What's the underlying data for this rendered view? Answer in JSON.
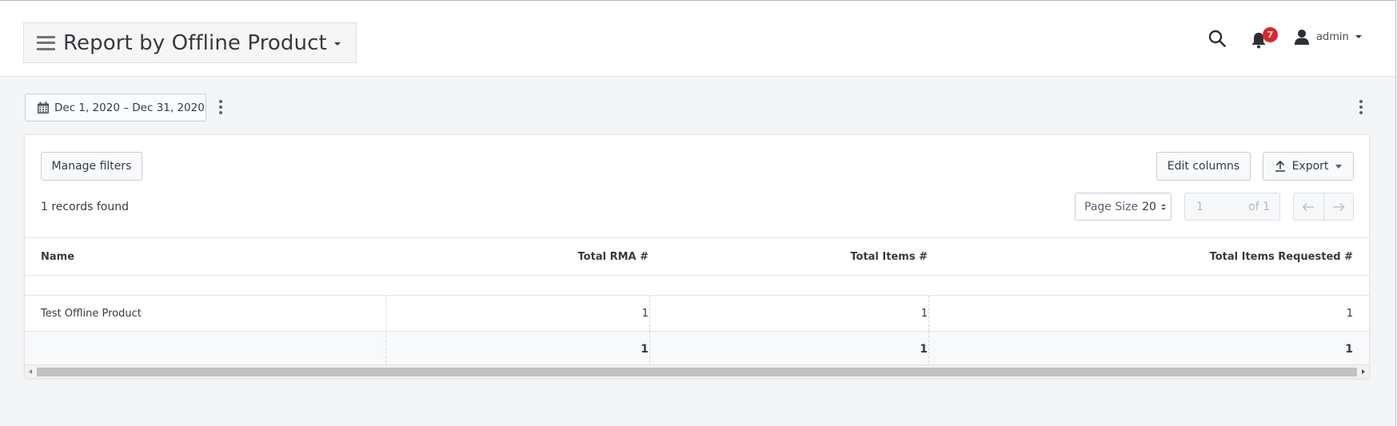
{
  "header": {
    "title": "Report by Offline Product",
    "notifications_count": "7",
    "user_name": "admin",
    "badge_color": "#e2232a"
  },
  "toolbar": {
    "date_range": "Dec 1, 2020 – Dec 31, 2020"
  },
  "grid": {
    "manage_filters_label": "Manage filters",
    "edit_columns_label": "Edit columns",
    "export_label": "Export",
    "records_found": "1 records found",
    "page_size_label": "Page Size",
    "page_size_value": "20",
    "current_page": "1",
    "page_total": "of 1",
    "columns": [
      "Name",
      "Total RMA #",
      "Total Items #",
      "Total Items Requested #"
    ],
    "rows": [
      [
        "Test Offline Product",
        "1",
        "1",
        "1"
      ]
    ],
    "totals": [
      "",
      "1",
      "1",
      "1"
    ]
  }
}
